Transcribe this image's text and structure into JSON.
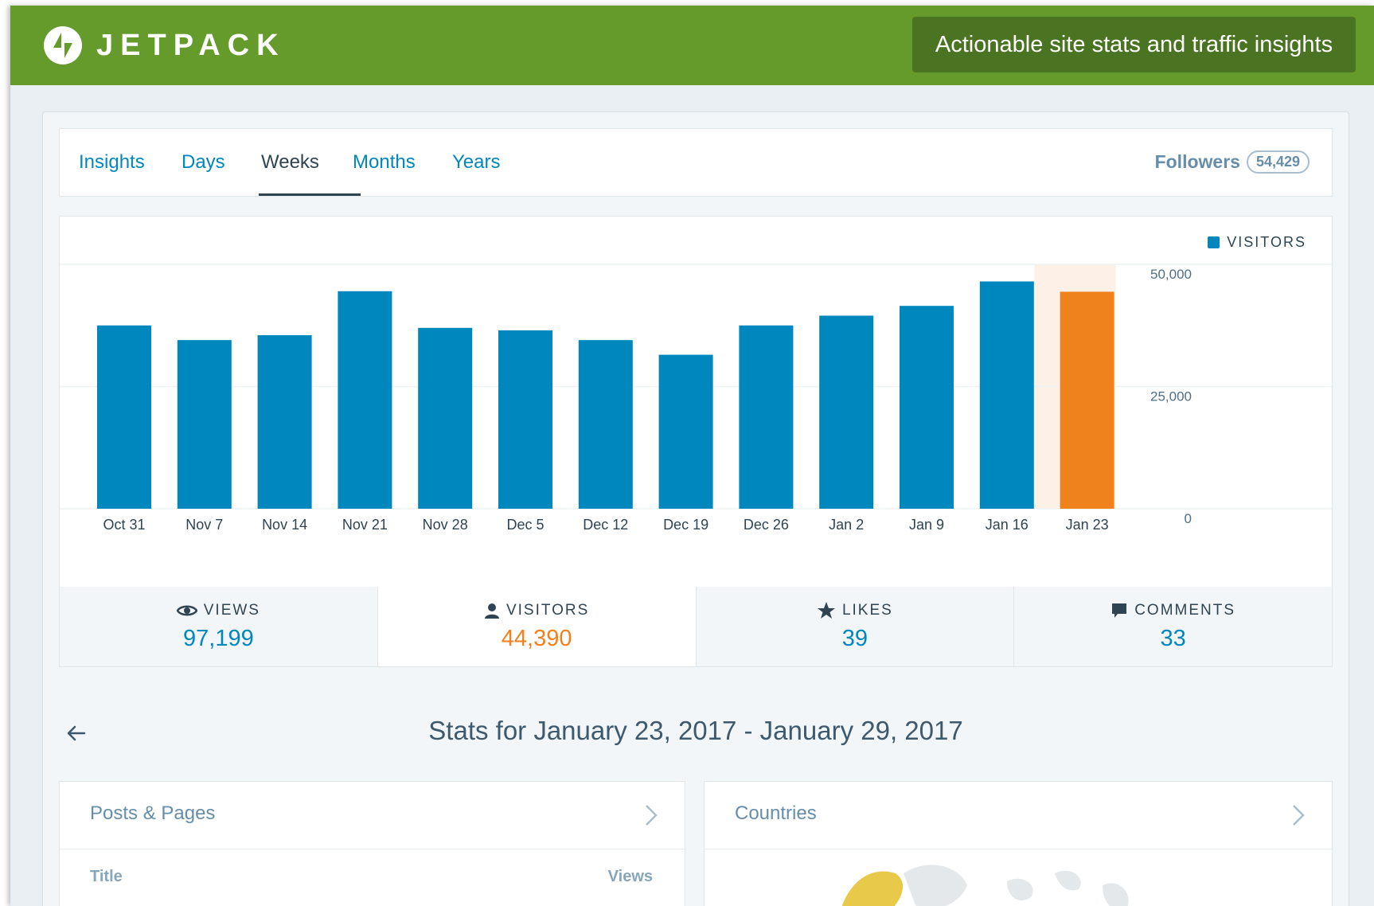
{
  "banner": {
    "brand": "JETPACK",
    "tagline": "Actionable site stats and traffic insights",
    "color": "#649b2b"
  },
  "tabs": [
    {
      "label": "Insights",
      "active": false
    },
    {
      "label": "Days",
      "active": false
    },
    {
      "label": "Weeks",
      "active": true
    },
    {
      "label": "Months",
      "active": false
    },
    {
      "label": "Years",
      "active": false
    }
  ],
  "followers": {
    "label": "Followers",
    "count": "54,429"
  },
  "chart_data": {
    "type": "bar",
    "legend": "VISITORS",
    "categories": [
      "Oct 31",
      "Nov 7",
      "Nov 14",
      "Nov 21",
      "Nov 28",
      "Dec 5",
      "Dec 12",
      "Dec 19",
      "Dec 26",
      "Jan 2",
      "Jan 9",
      "Jan 16",
      "Jan 23"
    ],
    "series": [
      {
        "name": "VISITORS",
        "values": [
          37500,
          34500,
          35500,
          44500,
          37000,
          36500,
          34500,
          31500,
          37500,
          39500,
          41500,
          46500,
          44390
        ]
      }
    ],
    "highlight_index": 12,
    "ylim": [
      0,
      50000
    ],
    "yticks": [
      "50,000",
      "25,000",
      "0"
    ],
    "colors": {
      "bar": "#0087be",
      "highlight": "#f0821e",
      "highlight_band": "#fdf1e7"
    }
  },
  "summary": [
    {
      "key": "views",
      "label": "VIEWS",
      "value": "97,199",
      "icon": "eye-icon",
      "selected": false
    },
    {
      "key": "visitors",
      "label": "VISITORS",
      "value": "44,390",
      "icon": "person-icon",
      "selected": true
    },
    {
      "key": "likes",
      "label": "LIKES",
      "value": "39",
      "icon": "star-icon",
      "selected": false
    },
    {
      "key": "comments",
      "label": "COMMENTS",
      "value": "33",
      "icon": "comment-icon",
      "selected": false
    }
  ],
  "period": {
    "title": "Stats for January 23, 2017 - January 29, 2017"
  },
  "modules": {
    "posts": {
      "title": "Posts & Pages",
      "col_title": "Title",
      "col_views": "Views"
    },
    "countries": {
      "title": "Countries"
    }
  }
}
